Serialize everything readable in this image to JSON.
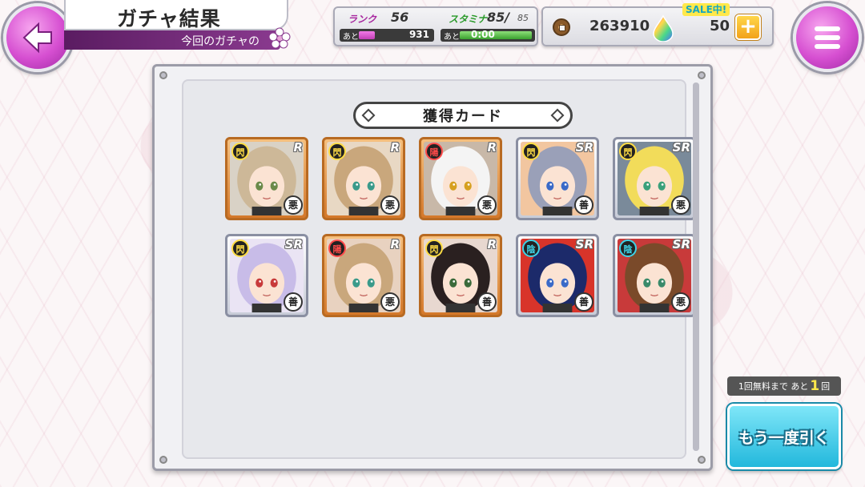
{
  "header": {
    "title": "ガチャ結果",
    "subtitle": "今回のガチャの"
  },
  "status": {
    "rank_label": "ランク",
    "rank_value": "56",
    "rank_bar_prefix": "あと",
    "rank_bar_value": "931",
    "rank_progress": 0.22,
    "stamina_label": "スタミナ",
    "stamina_value": "85/",
    "stamina_max": "85",
    "stamina_bar_prefix": "あと",
    "stamina_bar_value": "0:00",
    "stamina_progress": 1.0
  },
  "currency": {
    "coins": "263910",
    "gems": "50",
    "sale_badge": "SALE中!",
    "plus_label": "+"
  },
  "results": {
    "header": "獲得カード",
    "cards": [
      {
        "rarity": "R",
        "attr": "閃",
        "align": "悪",
        "tier": "r",
        "hair": "#cdb898",
        "bg": "#d9d2c6",
        "eye": "#6a8a4a"
      },
      {
        "rarity": "R",
        "attr": "閃",
        "align": "悪",
        "tier": "r",
        "hair": "#c9a77c",
        "bg": "#e8d8c4",
        "eye": "#3a9a8a"
      },
      {
        "rarity": "R",
        "attr": "陽",
        "align": "悪",
        "tier": "r",
        "hair": "#f4f4f4",
        "bg": "#c8b8a8",
        "eye": "#d6a020"
      },
      {
        "rarity": "SR",
        "attr": "閃",
        "align": "善",
        "tier": "sr",
        "hair": "#9aa0b8",
        "bg": "#f2c6a0",
        "eye": "#3a6ac8"
      },
      {
        "rarity": "SR",
        "attr": "閃",
        "align": "悪",
        "tier": "sr",
        "hair": "#f2dc5a",
        "bg": "#7a8a9a",
        "eye": "#3aa07a"
      },
      {
        "rarity": "SR",
        "attr": "閃",
        "align": "善",
        "tier": "sr",
        "hair": "#c8bce8",
        "bg": "#eae4f4",
        "eye": "#c83a3a"
      },
      {
        "rarity": "R",
        "attr": "陽",
        "align": "悪",
        "tier": "r",
        "hair": "#c9a77c",
        "bg": "#e8d2c0",
        "eye": "#3a9a8a"
      },
      {
        "rarity": "R",
        "attr": "閃",
        "align": "善",
        "tier": "r",
        "hair": "#2a2020",
        "bg": "#e8d8d0",
        "eye": "#3a6a3a"
      },
      {
        "rarity": "SR",
        "attr": "陰",
        "align": "善",
        "tier": "sr",
        "hair": "#1c2a6a",
        "bg": "#d8342a",
        "eye": "#3a6ac8"
      },
      {
        "rarity": "SR",
        "attr": "陰",
        "align": "悪",
        "tier": "sr",
        "hair": "#7a4a2a",
        "bg": "#c83a3a",
        "eye": "#3a8a6a"
      }
    ]
  },
  "free_info": {
    "prefix": "1回無料まで あと",
    "count": "1",
    "suffix": "回"
  },
  "pull_again_label": "もう一度引く"
}
